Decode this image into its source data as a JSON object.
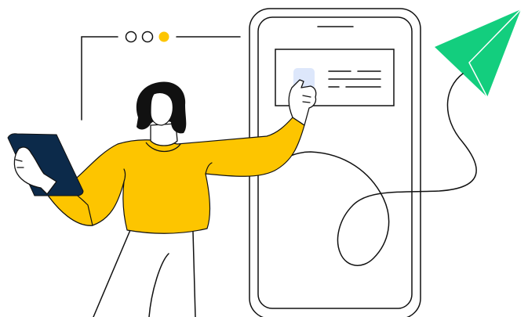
{
  "illustration": {
    "subject": "woman-pointing-at-phone",
    "colors": {
      "outline": "#111111",
      "sweater": "#FDC500",
      "tablet": "#0C2A4A",
      "paper_plane": "#13CE7E",
      "dot_active": "#FDC500",
      "highlight": "#DDE7FB",
      "background": "#FFFFFF"
    },
    "carousel_dots": {
      "count": 3,
      "active_index": 2
    },
    "icons": [
      "paper-plane-icon",
      "phone-frame",
      "tablet-icon",
      "pagination-dots"
    ]
  }
}
